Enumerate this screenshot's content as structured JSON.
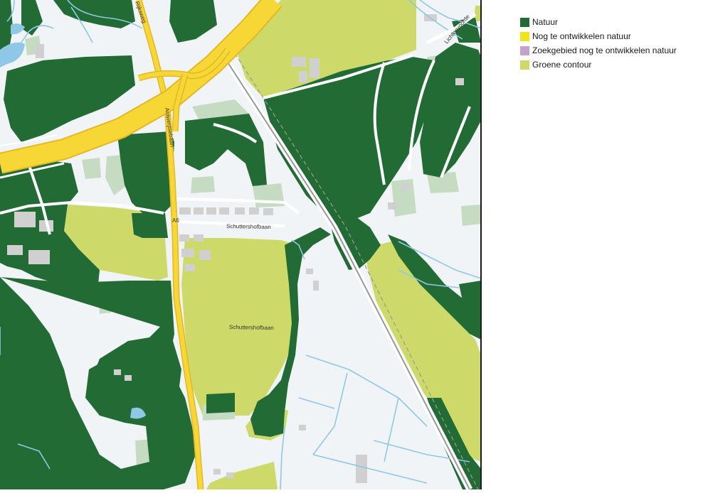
{
  "colors": {
    "background": "#f1f4f7",
    "nature": "#236b35",
    "nature_to_develop": "#f0e516",
    "search_area": "#c3a3c9",
    "green_contour": "#cdda6a",
    "light_green": "#c6dcc2",
    "building": "#d0d0d0",
    "water": "#8fc8e6",
    "motorway": "#f7d735",
    "road_edge": "#e3b826",
    "railway": "#999999"
  },
  "legend": {
    "items": [
      {
        "label": "Natuur",
        "color": "#236b35"
      },
      {
        "label": "Nog te ontwikkelen natuur",
        "color": "#f0e516"
      },
      {
        "label": "Zoekgebied nog te ontwikkelen natuur",
        "color": "#c3a3c9"
      },
      {
        "label": "Groene contour",
        "color": "#cdda6a"
      }
    ]
  },
  "map": {
    "street_labels": {
      "schuttersdreef": "Schuttershofbaan",
      "schuttersdreef_lower": "Schuttershofbaan",
      "antwerpsebaan": "Antwerpsebaan",
      "north_road": "Rijksweg",
      "northeast_road": "Lichtenvoorde",
      "road_number": "A6"
    }
  }
}
